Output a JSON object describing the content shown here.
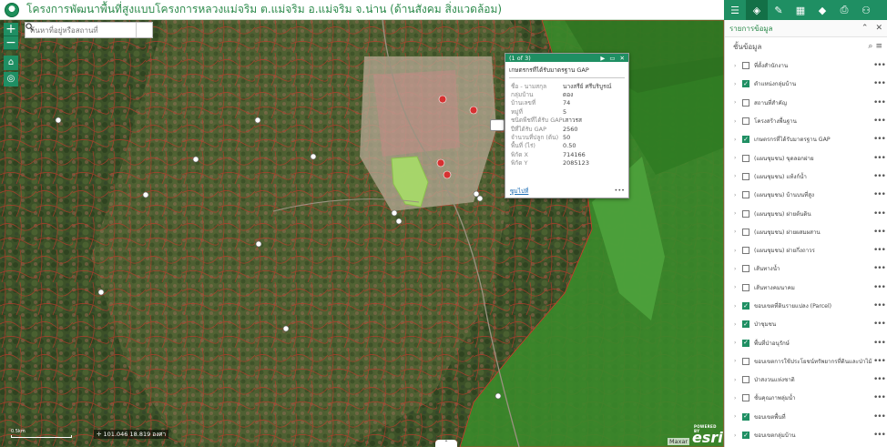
{
  "app": {
    "title": "โครงการพัฒนาพื้นที่สูงแบบโครงการหลวงแม่จริม ต.แม่จริม อ.แม่จริม จ.น่าน (ด้านสังคม สิ่งแวดล้อม)"
  },
  "search": {
    "placeholder": "ค้นหาที่อยู่หรือสถานที่"
  },
  "map_controls": {
    "zoom_in": "+",
    "zoom_out": "−",
    "home": "⌂",
    "locate": "◎"
  },
  "popup": {
    "counter": "(1 of 3)",
    "title": "เกษตรกรที่ได้รับมาตรฐาน GAP",
    "fields": [
      {
        "key": "ชื่อ - นามสกุล",
        "value": "นางสรีย์ ศรีบริบูรณ์"
      },
      {
        "key": "กลุ่มบ้าน",
        "value": "ดอง"
      },
      {
        "key": "บ้านเลขที่",
        "value": "74"
      },
      {
        "key": "หมู่ที่",
        "value": "5"
      },
      {
        "key": "ชนิดพืชที่ได้รับ GAP",
        "value": "เสาวรส"
      },
      {
        "key": "ปีที่ได้รับ GAP",
        "value": "2560"
      },
      {
        "key": "จำนวนที่ปลูก (ต้น)",
        "value": "50"
      },
      {
        "key": "พื้นที่ (ไร่)",
        "value": "0.50"
      },
      {
        "key": "พิกัด X",
        "value": "714166"
      },
      {
        "key": "พิกัด Y",
        "value": "2085123"
      }
    ],
    "zoom_link": "ซูมไปที่",
    "more": "•••"
  },
  "status": {
    "scale": "0.5km",
    "coords": "101.046 18.819 องศา",
    "expand": "⌃",
    "attribution": "Maxar",
    "esri": "esri",
    "esri_powered": "POWERED BY"
  },
  "toolbar": {
    "items": [
      {
        "name": "legend-icon",
        "glyph": "☰"
      },
      {
        "name": "layers-icon",
        "glyph": "◈"
      },
      {
        "name": "draw-icon",
        "glyph": "✎"
      },
      {
        "name": "basemap-icon",
        "glyph": "▦"
      },
      {
        "name": "bookmark-icon",
        "glyph": "◆"
      },
      {
        "name": "print-icon",
        "glyph": "⎙"
      },
      {
        "name": "about-icon",
        "glyph": "⚇"
      }
    ]
  },
  "panel": {
    "title": "รายการข้อมูล",
    "collapse": "⌃",
    "close": "✕",
    "subheader": "ชั้นข้อมูล",
    "search_glyph": "⌕",
    "filter_glyph": "≡",
    "layers": [
      {
        "label": "ที่ตั้งสำนักงาน",
        "checked": false
      },
      {
        "label": "ตำแหน่งกลุ่มบ้าน",
        "checked": true
      },
      {
        "label": "สถานที่สำคัญ",
        "checked": false
      },
      {
        "label": "โครงสร้างพื้นฐาน",
        "checked": false
      },
      {
        "label": "เกษตรกรที่ได้รับมาตรฐาน GAP",
        "checked": true
      },
      {
        "label": "(แผนชุมชน) ขุดลอกฝาย",
        "checked": false
      },
      {
        "label": "(แผนชุมชน) แท้งก์น้ำ",
        "checked": false
      },
      {
        "label": "(แผนชุมชน) บ้านบนที่สูง",
        "checked": false
      },
      {
        "label": "(แผนชุมชน) ฝายต้นดิน",
        "checked": false
      },
      {
        "label": "(แผนชุมชน) ฝายผสมผสาน",
        "checked": false
      },
      {
        "label": "(แผนชุมชน) ฝายกึ่งถาวร",
        "checked": false
      },
      {
        "label": "เส้นทางน้ำ",
        "checked": false
      },
      {
        "label": "เส้นทางคมนาคม",
        "checked": false
      },
      {
        "label": "ขอบเขตที่ดินรายแปลง (Parcel)",
        "checked": true
      },
      {
        "label": "ป่าชุมชน",
        "checked": true
      },
      {
        "label": "พื้นที่ป่าอนุรักษ์",
        "checked": true
      },
      {
        "label": "ขอบเขตการใช้ประโยชน์ทรัพยากรที่ดินและป่าไม้",
        "checked": false
      },
      {
        "label": "ป่าสงวนแห่งชาติ",
        "checked": false
      },
      {
        "label": "ชั้นคุณภาพลุ่มน้ำ",
        "checked": false
      },
      {
        "label": "ขอบเขตพื้นที่",
        "checked": true
      },
      {
        "label": "ขอบเขตกลุ่มบ้าน",
        "checked": true
      }
    ],
    "more": "•••",
    "chevron": "›"
  }
}
